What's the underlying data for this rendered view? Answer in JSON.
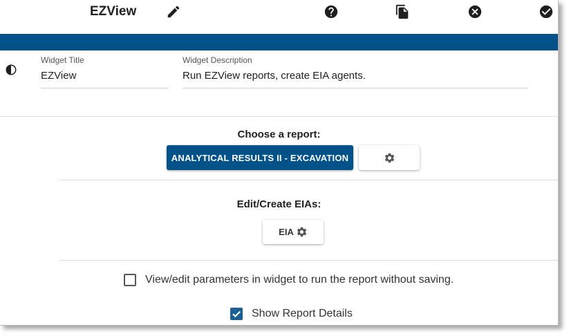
{
  "header": {
    "title": "EZView",
    "icons": [
      "pencil-icon",
      "help-icon",
      "copy-icon",
      "close-circle-icon",
      "check-circle-icon"
    ]
  },
  "colors": {
    "brand_blue": "#005289",
    "icon_dark": "#1f1f1f",
    "checkbox_blue": "#1c5f95"
  },
  "widget": {
    "title_label": "Widget Title",
    "title_value": "EZView",
    "description_label": "Widget Description",
    "description_value": "Run EZView reports, create EIA agents."
  },
  "report": {
    "heading": "Choose a report:",
    "selected_report": "ANALYTICAL RESULTS II - EXCAVATION"
  },
  "eia": {
    "heading": "Edit/Create EIAs:",
    "button_label": "EIA"
  },
  "options": {
    "view_edit_params": {
      "label": "View/edit parameters in widget to run the report without saving.",
      "checked": false
    },
    "show_report_details": {
      "label": "Show Report Details",
      "checked": true
    }
  }
}
